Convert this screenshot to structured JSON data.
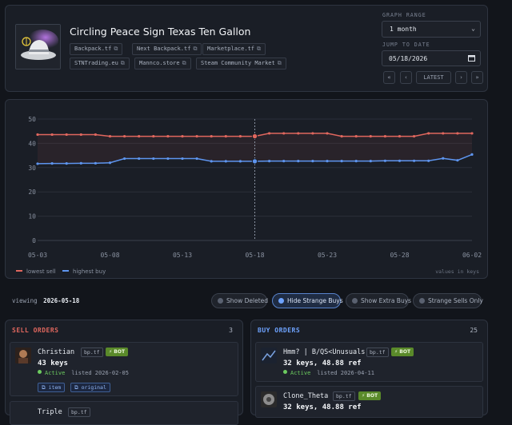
{
  "item": {
    "name": "Circling Peace Sign Texas Ten Gallon",
    "links": [
      "Backpack.tf",
      "Next Backpack.tf",
      "Marketplace.tf",
      "STNTrading.eu",
      "Mannco.store",
      "Steam Community Market"
    ]
  },
  "controls": {
    "graph_range_label": "GRAPH RANGE",
    "graph_range_value": "1 month",
    "jump_label": "JUMP TO DATE",
    "jump_value": "05/18/2026",
    "nav": [
      "«",
      "‹",
      "LATEST",
      "›",
      "»"
    ]
  },
  "chart_data": {
    "type": "line",
    "x": [
      "05-03",
      "05-04",
      "05-05",
      "05-06",
      "05-07",
      "05-08",
      "05-09",
      "05-10",
      "05-11",
      "05-12",
      "05-13",
      "05-14",
      "05-15",
      "05-16",
      "05-17",
      "05-18",
      "05-19",
      "05-20",
      "05-21",
      "05-22",
      "05-23",
      "05-24",
      "05-25",
      "05-26",
      "05-27",
      "05-28",
      "05-29",
      "05-30",
      "05-31",
      "06-01",
      "06-02"
    ],
    "x_ticks": [
      "05-03",
      "05-08",
      "05-13",
      "05-18",
      "05-23",
      "05-28",
      "06-02"
    ],
    "y_ticks": [
      0,
      10,
      20,
      30,
      40,
      50
    ],
    "ylim": [
      0,
      50
    ],
    "series": [
      {
        "name": "lowest sell",
        "color": "#e0675e",
        "values": [
          43.6,
          43.6,
          43.6,
          43.6,
          43.6,
          42.9,
          42.9,
          42.9,
          42.9,
          42.9,
          42.9,
          42.9,
          42.9,
          42.9,
          42.9,
          42.9,
          44.1,
          44.1,
          44.1,
          44.1,
          44.1,
          42.9,
          42.9,
          42.9,
          42.9,
          42.9,
          42.9,
          44.1,
          44.1,
          44.1,
          44.1
        ]
      },
      {
        "name": "highest buy",
        "color": "#5e95ef",
        "values": [
          31.6,
          31.7,
          31.7,
          31.8,
          31.8,
          32.0,
          33.7,
          33.7,
          33.7,
          33.7,
          33.7,
          33.7,
          32.6,
          32.6,
          32.6,
          32.6,
          32.7,
          32.7,
          32.7,
          32.7,
          32.7,
          32.7,
          32.7,
          32.7,
          32.8,
          32.8,
          32.8,
          32.8,
          33.8,
          33.0,
          35.4
        ]
      }
    ],
    "marker_x": "05-18",
    "marker_values": [
      42.9,
      32.6
    ],
    "footnote": "values in keys",
    "grid": true,
    "legend_position": "bottom-left"
  },
  "toolbar": {
    "viewing_label": "viewing",
    "viewing_date": "2026-05-18",
    "filters": [
      {
        "label": "Show Deleted",
        "active": false
      },
      {
        "label": "Hide Strange Buys",
        "active": true
      },
      {
        "label": "Show Extra Buys",
        "active": false
      },
      {
        "label": "Strange Sells Only",
        "active": false
      }
    ]
  },
  "sell_orders": {
    "title": "SELL ORDERS",
    "count": "3",
    "orders": [
      {
        "user": "Christian",
        "tag": "bp.tf",
        "bot": "⚡ BOT",
        "price": "43 keys",
        "status": "Active",
        "listed": "listed 2026-02-05",
        "links": [
          "item",
          "original"
        ]
      },
      {
        "user": "Triple",
        "tag": "bp.tf"
      }
    ]
  },
  "buy_orders": {
    "title": "BUY ORDERS",
    "count": "25",
    "orders": [
      {
        "user": "Hmm? | B/QS<Unusuals",
        "tag": "bp.tf",
        "bot": "⚡ BOT",
        "price": "32 keys, 48.88 ref",
        "status": "Active",
        "listed": "listed 2026-04-11"
      },
      {
        "user": "Clone_Theta",
        "tag": "bp.tf",
        "bot": "⚡ BOT",
        "price": "32 keys, 48.88 ref"
      }
    ]
  }
}
